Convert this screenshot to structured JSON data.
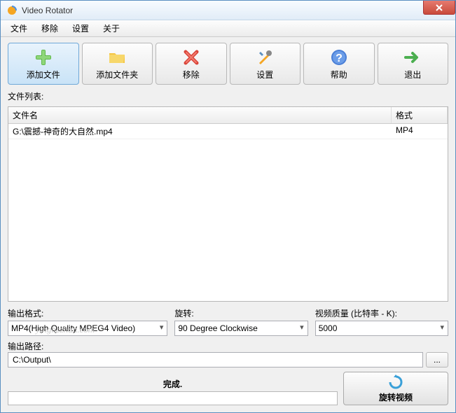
{
  "window": {
    "title": "Video Rotator"
  },
  "menu": {
    "file": "文件",
    "remove": "移除",
    "settings": "设置",
    "about": "关于"
  },
  "toolbar": {
    "add_file": "添加文件",
    "add_folder": "添加文件夹",
    "remove": "移除",
    "settings": "设置",
    "help": "帮助",
    "exit": "退出"
  },
  "file_list": {
    "label": "文件列表:",
    "col_name": "文件名",
    "col_format": "格式",
    "rows": [
      {
        "name": "G:\\震撼-神奇的大自然.mp4",
        "format": "MP4"
      }
    ]
  },
  "output_format": {
    "label": "输出格式:",
    "value": "MP4(High Quality MPEG4 Video)"
  },
  "rotation": {
    "label": "旋转:",
    "value": "90 Degree Clockwise"
  },
  "quality": {
    "label": "视频质量 (比特率 - K):",
    "value": "5000"
  },
  "output_path": {
    "label": "输出路径:",
    "value": "C:\\Output\\",
    "browse": "..."
  },
  "progress": {
    "label": "完成."
  },
  "rotate_button": "旋转视频",
  "watermark": "yinghezhan.com"
}
